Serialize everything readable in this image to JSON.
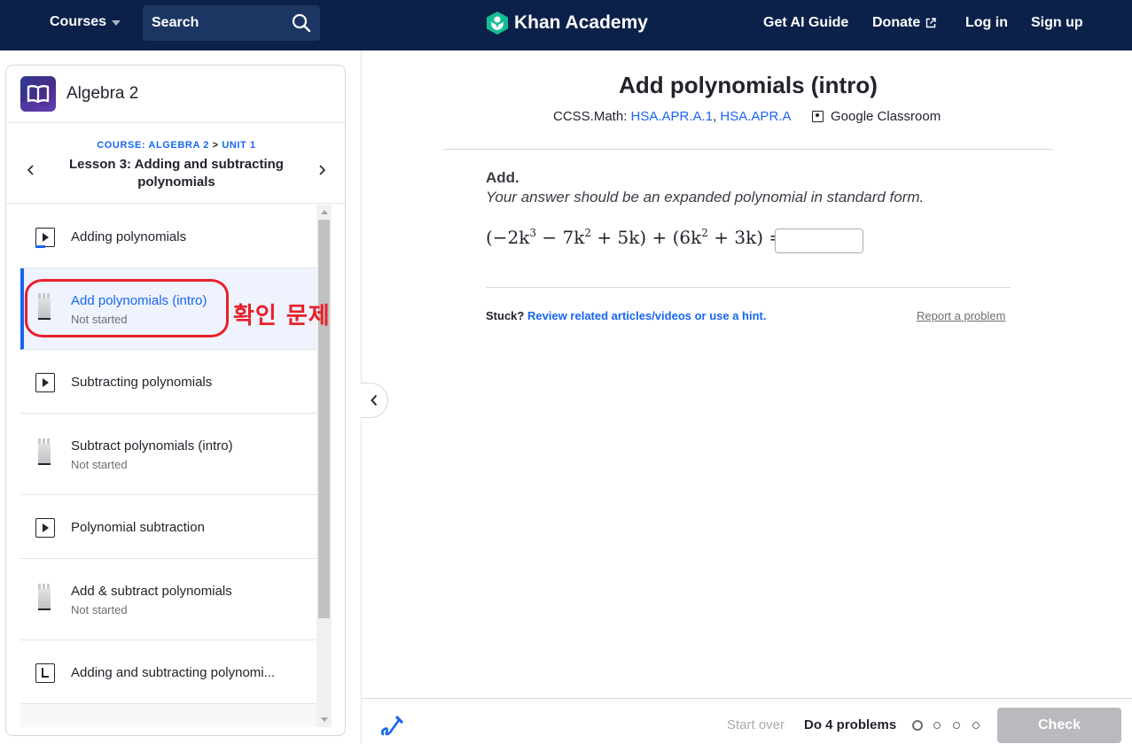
{
  "nav": {
    "courses": "Courses",
    "search": "Search",
    "logo": "Khan Academy",
    "links": [
      "Get AI Guide",
      "Donate",
      "Log in",
      "Sign up"
    ]
  },
  "sidebar": {
    "course_title": "Algebra 2",
    "breadcrumb": {
      "course": "COURSE: ALGEBRA 2",
      "sep": ">",
      "unit": "UNIT 1"
    },
    "lesson_title": "Lesson 3: Adding and subtracting polynomials",
    "items": [
      {
        "type": "video",
        "label": "Adding polynomials",
        "status": ""
      },
      {
        "type": "exercise",
        "label": "Add polynomials (intro)",
        "status": "Not started",
        "active": true
      },
      {
        "type": "video",
        "label": "Subtracting polynomials",
        "status": ""
      },
      {
        "type": "exercise",
        "label": "Subtract polynomials (intro)",
        "status": "Not started"
      },
      {
        "type": "video",
        "label": "Polynomial subtraction",
        "status": ""
      },
      {
        "type": "exercise",
        "label": "Add & subtract polynomials",
        "status": "Not started"
      },
      {
        "type": "article",
        "label": "Adding and subtracting polynomi...",
        "status": ""
      }
    ]
  },
  "annotation": {
    "text": "확인 문제",
    "color": "#e8202a"
  },
  "main": {
    "title": "Add polynomials (intro)",
    "standards_prefix": "CCSS.Math:",
    "standards": [
      "HSA.APR.A.1",
      "HSA.APR.A"
    ],
    "google_classroom": "Google Classroom",
    "question": {
      "heading": "Add.",
      "instruction": "Your answer should be an expanded polynomial in standard form.",
      "expression_parts": [
        "(−2k",
        "3",
        " − 7k",
        "2",
        " + 5k) + (6k",
        "2",
        " + 3k) ="
      ],
      "answer_value": ""
    },
    "stuck": "Stuck?",
    "stuck_link": "Review related articles/videos or use a hint.",
    "report": "Report a problem"
  },
  "footer": {
    "start_over": "Start over",
    "do_problems": "Do 4 problems",
    "check": "Check"
  },
  "colors": {
    "nav_bg": "#0b2149",
    "accent": "#1865f2",
    "logo_green": "#14bf96",
    "check_disabled": "#b8babe"
  }
}
